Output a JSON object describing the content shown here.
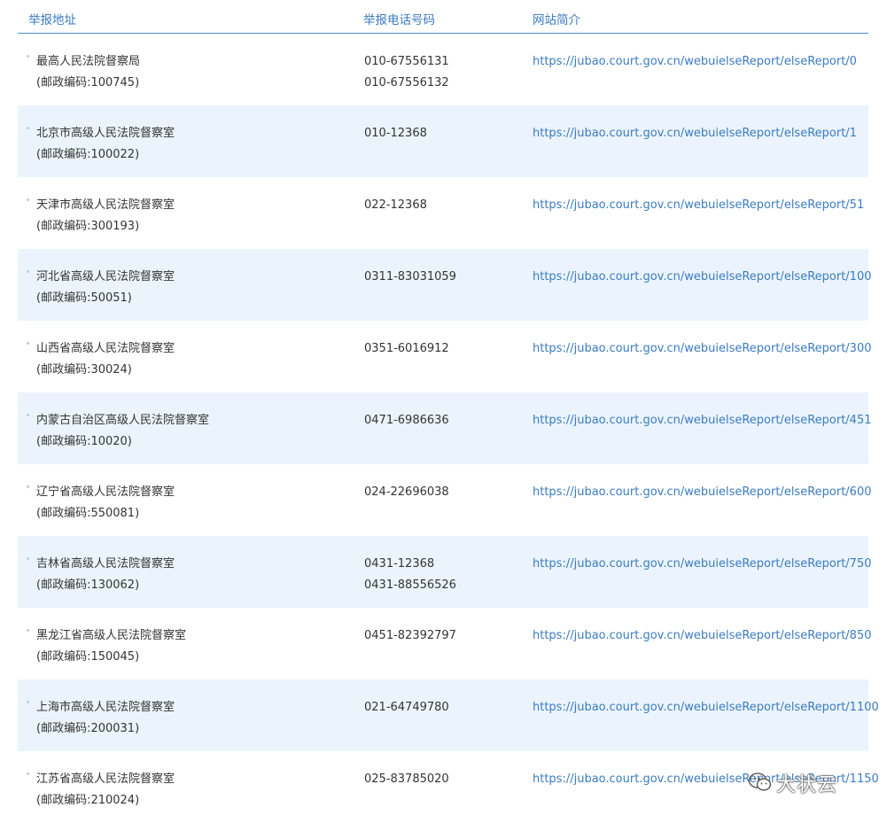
{
  "header": {
    "col_address": "举报地址",
    "col_phone": "举报电话号码",
    "col_site": "网站简介"
  },
  "rows": [
    {
      "name": "最高人民法院督察局",
      "postcode": "(邮政编码:100745)",
      "phones": [
        "010-67556131",
        "010-67556132"
      ],
      "url": "https://jubao.court.gov.cn/webuielseReport/elseReport/0"
    },
    {
      "name": "北京市高级人民法院督察室",
      "postcode": "(邮政编码:100022)",
      "phones": [
        "010-12368"
      ],
      "url": "https://jubao.court.gov.cn/webuielseReport/elseReport/1"
    },
    {
      "name": "天津市高级人民法院督察室",
      "postcode": "(邮政编码:300193)",
      "phones": [
        "022-12368"
      ],
      "url": "https://jubao.court.gov.cn/webuielseReport/elseReport/51"
    },
    {
      "name": "河北省高级人民法院督察室",
      "postcode": "(邮政编码:50051)",
      "phones": [
        "0311-83031059"
      ],
      "url": "https://jubao.court.gov.cn/webuielseReport/elseReport/100"
    },
    {
      "name": "山西省高级人民法院督察室",
      "postcode": "(邮政编码:30024)",
      "phones": [
        "0351-6016912"
      ],
      "url": "https://jubao.court.gov.cn/webuielseReport/elseReport/300"
    },
    {
      "name": "内蒙古自治区高级人民法院督察室",
      "postcode": "(邮政编码:10020)",
      "phones": [
        "0471-6986636"
      ],
      "url": "https://jubao.court.gov.cn/webuielseReport/elseReport/451"
    },
    {
      "name": "辽宁省高级人民法院督察室",
      "postcode": "(邮政编码:550081)",
      "phones": [
        "024-22696038"
      ],
      "url": "https://jubao.court.gov.cn/webuielseReport/elseReport/600"
    },
    {
      "name": "吉林省高级人民法院督察室",
      "postcode": "(邮政编码:130062)",
      "phones": [
        "0431-12368",
        "0431-88556526"
      ],
      "url": "https://jubao.court.gov.cn/webuielseReport/elseReport/750"
    },
    {
      "name": "黑龙江省高级人民法院督察室",
      "postcode": "(邮政编码:150045)",
      "phones": [
        "0451-82392797"
      ],
      "url": "https://jubao.court.gov.cn/webuielseReport/elseReport/850"
    },
    {
      "name": "上海市高级人民法院督察室",
      "postcode": "(邮政编码:200031)",
      "phones": [
        "021-64749780"
      ],
      "url": "https://jubao.court.gov.cn/webuielseReport/elseReport/1100"
    },
    {
      "name": "江苏省高级人民法院督察室",
      "postcode": "(邮政编码:210024)",
      "phones": [
        "025-83785020"
      ],
      "url": "https://jubao.court.gov.cn/webuielseReport/elseReport/1150"
    }
  ],
  "watermark": {
    "text": "大状云",
    "icon": "wechat-icon"
  },
  "colors": {
    "accent": "#3b7bc0",
    "row_alt_bg": "#ebf4fc",
    "header_rule": "#4a90c9"
  }
}
